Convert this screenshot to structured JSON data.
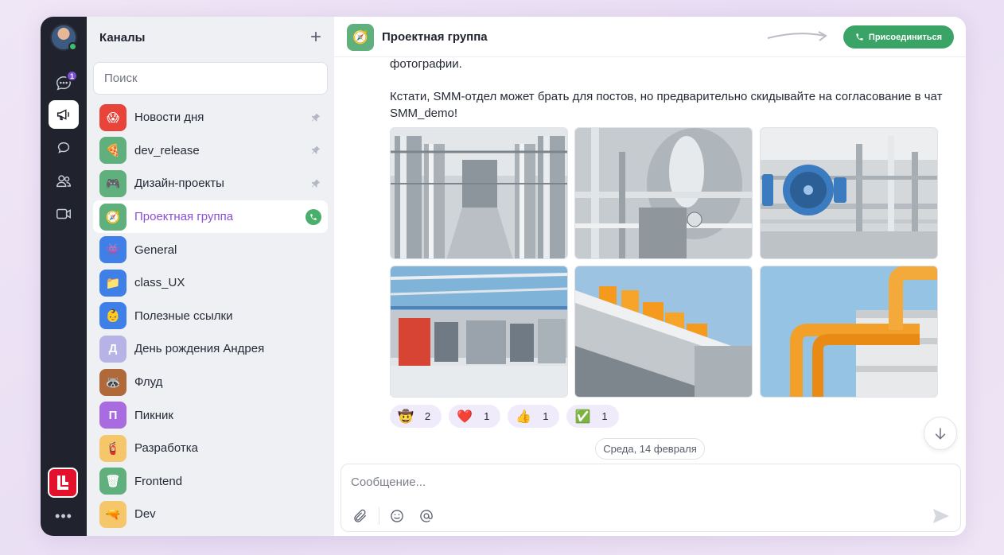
{
  "rail": {
    "badge_count": "1",
    "items": [
      {
        "name": "chats-icon"
      },
      {
        "name": "channels-icon"
      },
      {
        "name": "threads-icon"
      },
      {
        "name": "contacts-icon"
      },
      {
        "name": "video-icon"
      }
    ],
    "more": "•••"
  },
  "sidebar": {
    "title": "Каналы",
    "add": "+",
    "search_placeholder": "Поиск",
    "channels": [
      {
        "name": "Новости дня",
        "icon": "😱",
        "color": "#e8443a",
        "pinned": true
      },
      {
        "name": "dev_release",
        "icon": "🍕",
        "color": "#5fb07c",
        "pinned": true
      },
      {
        "name": "Дизайн-проекты",
        "icon": "🎮",
        "color": "#5fb07c",
        "pinned": true
      },
      {
        "name": "Проектная группа",
        "icon": "🧭",
        "color": "#5fb07c",
        "active": true,
        "call": true
      },
      {
        "name": "General",
        "icon": "👾",
        "color": "#3f7fe8"
      },
      {
        "name": "class_UX",
        "icon": "📁",
        "color": "#3f7fe8"
      },
      {
        "name": "Полезные ссылки",
        "icon": "👶",
        "color": "#3f7fe8"
      },
      {
        "name": "День рождения Андрея",
        "icon": "Д",
        "color": "#b8b3e6"
      },
      {
        "name": "Флуд",
        "icon": "🦝",
        "color": "#b06a3a"
      },
      {
        "name": "Пикник",
        "icon": "П",
        "color": "#a86be0"
      },
      {
        "name": "Разработка",
        "icon": "🧯",
        "color": "#f5c66a"
      },
      {
        "name": "Frontend",
        "icon": "🗑",
        "color": "#5fb07c"
      },
      {
        "name": "Dev",
        "icon": "🔫",
        "color": "#f5c66a"
      }
    ]
  },
  "chat": {
    "title": "Проектная группа",
    "join_label": "Присоединиться",
    "message_line1": "фотографии.",
    "message_line2": "Кстати, SMM-отдел может брать для постов, но предварительно скидывайте на согласование в чат SMM_demo!",
    "reactions": [
      {
        "emoji": "🤠",
        "count": "2"
      },
      {
        "emoji": "❤️",
        "count": "1"
      },
      {
        "emoji": "👍",
        "count": "1"
      },
      {
        "emoji": "✅",
        "count": "1"
      }
    ],
    "date_separator": "Среда, 14 февраля",
    "composer_placeholder": "Сообщение..."
  }
}
